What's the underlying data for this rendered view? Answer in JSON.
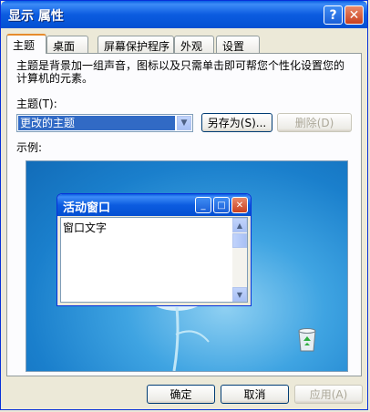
{
  "window": {
    "title": "显示 属性"
  },
  "title_buttons": {
    "help": "?",
    "close": "✕"
  },
  "tabs": [
    {
      "label": "主题",
      "active": true
    },
    {
      "label": "桌面",
      "active": false
    },
    {
      "label": "屏幕保护程序",
      "active": false
    },
    {
      "label": "外观",
      "active": false
    },
    {
      "label": "设置",
      "active": false
    }
  ],
  "theme_panel": {
    "description": "主题是背景加一组声音，图标以及只需单击即可帮您个性化设置您的计算机的元素。",
    "theme_label": "主题(T):",
    "theme_value": "更改的主题",
    "save_as_label": "另存为(S)...",
    "delete_label": "删除(D)",
    "example_label": "示例:"
  },
  "preview": {
    "window_title": "活动窗口",
    "window_text": "窗口文字"
  },
  "footer": {
    "ok_label": "确定",
    "cancel_label": "取消",
    "apply_label": "应用(A)"
  },
  "icons": {
    "help": "help-icon",
    "close": "close-icon",
    "dropdown": "chevron-down-icon",
    "recycle_bin": "recycle-bin-icon"
  },
  "colors": {
    "title_bar": "#0A5FE3",
    "selection": "#316AC5",
    "tab_accent": "#E68B2C",
    "dialog_bg": "#ECE9D8"
  }
}
